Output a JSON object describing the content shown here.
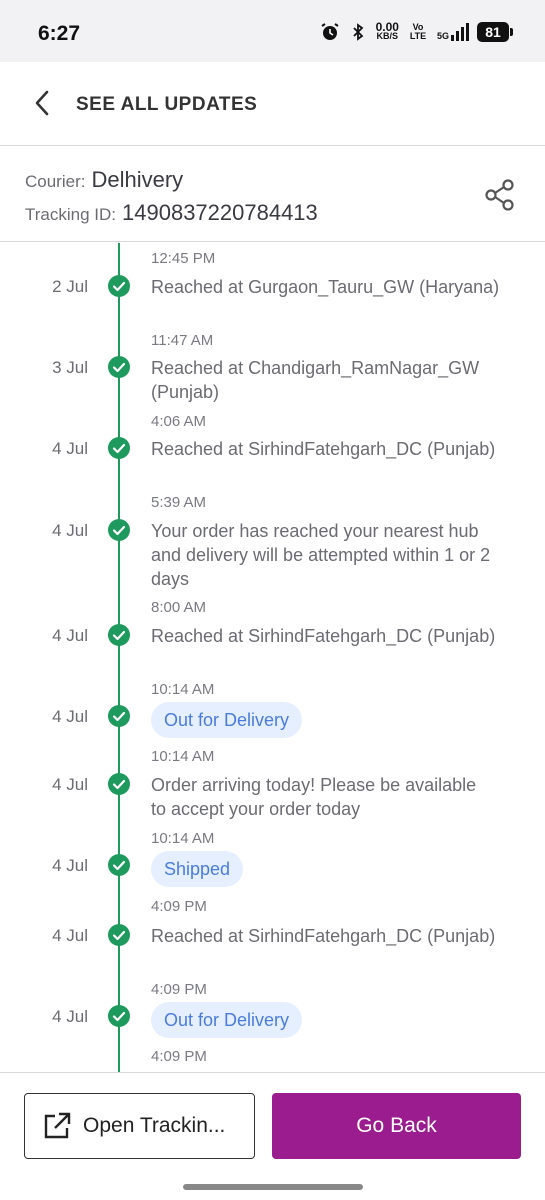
{
  "status_bar": {
    "time": "6:27",
    "net_speed": "0.00",
    "net_unit": "KB/S",
    "volte": "Vo LTE",
    "network": "5G",
    "battery": "81"
  },
  "header": {
    "title": "SEE ALL UPDATES"
  },
  "info": {
    "courier_label": "Courier:",
    "courier_value": "Delhivery",
    "tracking_label": "Tracking ID:",
    "tracking_value": "1490837220784413"
  },
  "events": [
    {
      "date": "",
      "message": "",
      "chip": false,
      "time": "12:45 PM"
    },
    {
      "date": "2 Jul",
      "message": "Reached at Gurgaon_Tauru_GW (Haryana)",
      "chip": false,
      "time": "11:47 AM"
    },
    {
      "date": "3 Jul",
      "message": "Reached at Chandigarh_RamNagar_GW (Punjab)",
      "chip": false,
      "time": "4:06 AM"
    },
    {
      "date": "4 Jul",
      "message": "Reached at SirhindFatehgarh_DC (Punjab)",
      "chip": false,
      "time": "5:39 AM"
    },
    {
      "date": "4 Jul",
      "message": "Your order has reached your nearest hub and delivery will be attempted within 1 or 2 days",
      "chip": false,
      "time": "8:00 AM"
    },
    {
      "date": "4 Jul",
      "message": "Reached at SirhindFatehgarh_DC (Punjab)",
      "chip": false,
      "time": "10:14 AM"
    },
    {
      "date": "4 Jul",
      "message": "Out for Delivery",
      "chip": true,
      "time": "10:14 AM"
    },
    {
      "date": "4 Jul",
      "message": "Order arriving today! Please be available to accept your order today",
      "chip": false,
      "time": "10:14 AM"
    },
    {
      "date": "4 Jul",
      "message": "Shipped",
      "chip": true,
      "time": "4:09 PM"
    },
    {
      "date": "4 Jul",
      "message": "Reached at SirhindFatehgarh_DC (Punjab)",
      "chip": false,
      "time": "4:09 PM"
    },
    {
      "date": "4 Jul",
      "message": "Out for Delivery",
      "chip": true,
      "time": "4:09 PM"
    }
  ],
  "footer": {
    "open_tracking_label": "Open Trackin...",
    "go_back_label": "Go Back"
  },
  "colors": {
    "accent": "#9b1c8e",
    "timeline_green": "#1f9a5e",
    "chip_bg": "#e6efff",
    "chip_text": "#4a7cdc"
  }
}
